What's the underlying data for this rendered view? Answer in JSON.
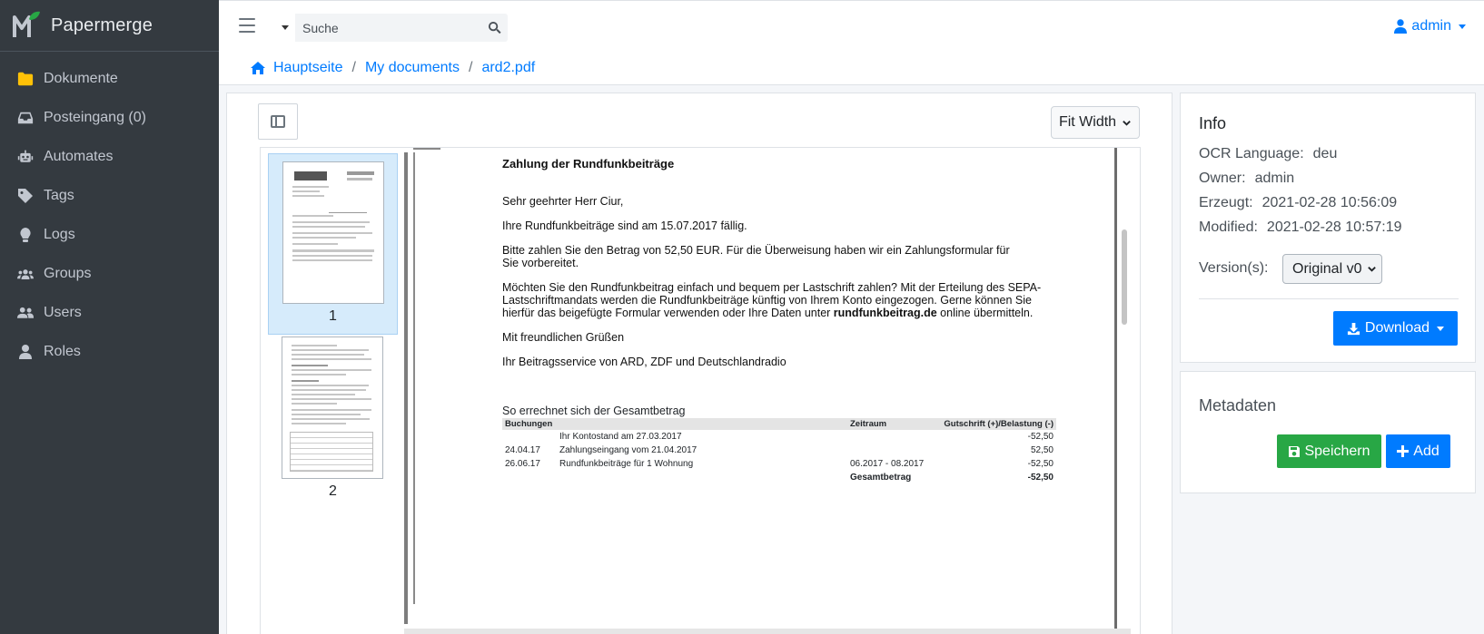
{
  "app": {
    "name": "Papermerge"
  },
  "sidebar": {
    "items": [
      {
        "label": "Dokumente",
        "icon": "folder-icon"
      },
      {
        "label": "Posteingang (0)",
        "icon": "inbox-icon"
      },
      {
        "label": "Automates",
        "icon": "robot-icon"
      },
      {
        "label": "Tags",
        "icon": "tag-icon"
      },
      {
        "label": "Logs",
        "icon": "lightbulb-icon"
      },
      {
        "label": "Groups",
        "icon": "users-group-icon"
      },
      {
        "label": "Users",
        "icon": "users-icon"
      },
      {
        "label": "Roles",
        "icon": "user-icon"
      }
    ]
  },
  "topbar": {
    "search_placeholder": "Suche",
    "user_label": "admin"
  },
  "breadcrumb": {
    "home": "Hauptseite",
    "folder": "My documents",
    "file": "ard2.pdf",
    "separator": "/"
  },
  "viewer": {
    "zoom_label": "Fit Width",
    "thumbnails": [
      {
        "number": "1",
        "active": true
      },
      {
        "number": "2",
        "active": false
      }
    ],
    "page": {
      "title": "Zahlung der Rundfunkbeiträge",
      "salutation": "Sehr geehrter Herr Ciur,",
      "p1": "Ihre Rundfunkbeiträge sind am 15.07.2017 fällig.",
      "p2a": "Bitte zahlen Sie den Betrag von 52,50 EUR. Für die Überweisung haben wir ein Zahlungsformular für",
      "p2b": "Sie vorbereitet.",
      "p3a": "Möchten Sie den Rundfunkbeitrag einfach und bequem per Lastschrift zahlen? Mit der Erteilung des SEPA-",
      "p3b": "Lastschriftmandats werden die Rundfunkbeiträge künftig von Ihrem Konto eingezogen. Gerne können Sie",
      "p3c_pre": "hierfür das beigefügte Formular verwenden oder Ihre Daten unter ",
      "p3c_bold": "rundfunkbeitrag.de",
      "p3c_post": " online übermitteln.",
      "closing": "Mit freundlichen Grüßen",
      "sender": "Ihr Beitragsservice von ARD, ZDF und Deutschlandradio",
      "summary_title": "So errechnet sich der Gesamtbetrag",
      "table": {
        "headers": [
          "Buchungen",
          "",
          "Zeitraum",
          "Gutschrift (+)/Belastung (-)"
        ],
        "rows": [
          [
            "",
            "Ihr Kontostand am 27.03.2017",
            "",
            "-52,50"
          ],
          [
            "24.04.17",
            "Zahlungseingang vom 21.04.2017",
            "",
            "52,50"
          ],
          [
            "26.06.17",
            "Rundfunkbeiträge für 1 Wohnung",
            "06.2017 - 08.2017",
            "-52,50"
          ]
        ],
        "total_label": "Gesamtbetrag",
        "total_value": "-52,50"
      }
    }
  },
  "info": {
    "title": "Info",
    "ocr_language_label": "OCR Language:",
    "ocr_language": "deu",
    "owner_label": "Owner:",
    "owner": "admin",
    "created_label": "Erzeugt:",
    "created": "2021-02-28 10:56:09",
    "modified_label": "Modified:",
    "modified": "2021-02-28 10:57:19",
    "versions_label": "Version(s):",
    "version_selected": "Original v0",
    "download_label": "Download"
  },
  "metadata": {
    "title": "Metadaten",
    "save_label": "Speichern",
    "add_label": "Add"
  },
  "colors": {
    "sidebar_bg": "#343a40",
    "primary": "#007bff",
    "success": "#28a745",
    "folder_icon": "#ffc107"
  }
}
